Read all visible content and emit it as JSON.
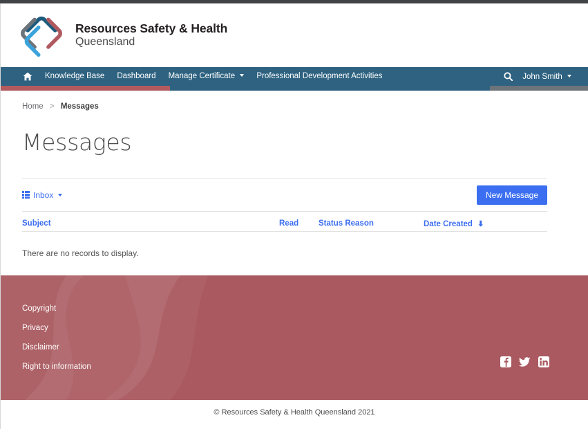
{
  "brand": {
    "line1": "Resources Safety & Health",
    "line2": "Queensland",
    "logo_icon": "rshq-diamond-logo",
    "colors": {
      "teal": "#1c5b7d",
      "red": "#b35a5f",
      "gray": "#6d7479",
      "light_blue": "#3ba3db"
    }
  },
  "nav": {
    "home_icon": "home-icon",
    "items": [
      {
        "label": "Knowledge Base",
        "has_caret": false
      },
      {
        "label": "Dashboard",
        "has_caret": false
      },
      {
        "label": "Manage Certificate",
        "has_caret": true
      },
      {
        "label": "Professional Development Activities",
        "has_caret": false
      }
    ],
    "search_icon": "search-icon",
    "user_label": "John Smith",
    "bar_color": "#2e6280"
  },
  "accent_bar": {
    "red": "#b35a5f",
    "blue": "#2e6280",
    "gray": "#6d7479"
  },
  "breadcrumb": {
    "home": "Home",
    "separator": ">",
    "current": "Messages"
  },
  "page": {
    "title": "Messages"
  },
  "toolbar": {
    "view_icon": "list-view-icon",
    "view_label": "Inbox",
    "new_message_label": "New Message",
    "button_color": "#3b6ef0"
  },
  "table": {
    "columns": [
      {
        "label": "Subject",
        "sorted": false
      },
      {
        "label": "Read",
        "sorted": false
      },
      {
        "label": "Status Reason",
        "sorted": false
      },
      {
        "label": "Date Created",
        "sorted": true,
        "sort_icon": "arrow-down-icon"
      }
    ],
    "rows": [],
    "empty_message": "There are no records to display."
  },
  "footer": {
    "background_color": "#a9595f",
    "links": [
      "Copyright",
      "Privacy",
      "Disclaimer",
      "Right to information"
    ],
    "social": [
      {
        "name": "facebook-icon",
        "glyph": "f"
      },
      {
        "name": "twitter-icon",
        "glyph": "twitter"
      },
      {
        "name": "linkedin-icon",
        "glyph": "in"
      }
    ]
  },
  "copyright": {
    "text": "© Resources Safety & Health Queensland 2021"
  }
}
